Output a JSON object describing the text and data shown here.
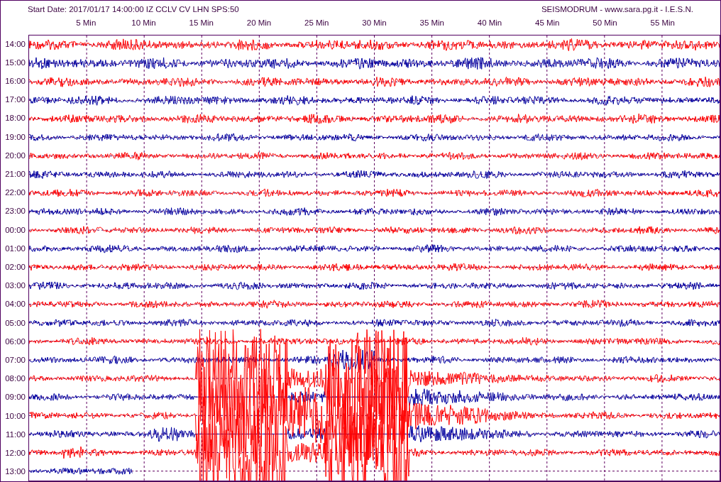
{
  "header": {
    "start_info": "Start Date: 2017/01/17 14:00:00 IZ CCLV CV LHN SPS:50",
    "credits": "SEISMODRUM - www.sara.pg.it - I.E.S.N."
  },
  "minute_labels": [
    "5 Min",
    "10 Min",
    "15 Min",
    "20 Min",
    "25 Min",
    "30 Min",
    "35 Min",
    "40 Min",
    "45 Min",
    "50 Min",
    "55 Min"
  ],
  "rows": [
    {
      "label": "14:00",
      "color": "#ff0000",
      "level": 1
    },
    {
      "label": "15:00",
      "color": "#0000a0",
      "level": 1
    },
    {
      "label": "16:00",
      "color": "#ff0000",
      "level": 1
    },
    {
      "label": "17:00",
      "color": "#0000a0",
      "level": 1
    },
    {
      "label": "18:00",
      "color": "#ff0000",
      "level": 1
    },
    {
      "label": "19:00",
      "color": "#0000a0",
      "level": 1
    },
    {
      "label": "20:00",
      "color": "#ff0000",
      "level": 1
    },
    {
      "label": "21:00",
      "color": "#0000a0",
      "level": 1
    },
    {
      "label": "22:00",
      "color": "#ff0000",
      "level": 1
    },
    {
      "label": "23:00",
      "color": "#0000a0",
      "level": 1
    },
    {
      "label": "00:00",
      "color": "#ff0000",
      "level": 1
    },
    {
      "label": "01:00",
      "color": "#0000a0",
      "level": 1
    },
    {
      "label": "02:00",
      "color": "#ff0000",
      "level": 1
    },
    {
      "label": "03:00",
      "color": "#0000a0",
      "level": 1
    },
    {
      "label": "04:00",
      "color": "#ff0000",
      "level": 1
    },
    {
      "label": "05:00",
      "color": "#0000a0",
      "level": 1
    },
    {
      "label": "06:00",
      "color": "#ff0000",
      "level": 1
    },
    {
      "label": "07:00",
      "color": "#0000a0",
      "level": 1
    },
    {
      "label": "08:00",
      "color": "#ff0000",
      "level": 1
    },
    {
      "label": "09:00",
      "color": "#0000a0",
      "level": 1
    },
    {
      "label": "10:00",
      "color": "#ff0000",
      "level": 1
    },
    {
      "label": "11:00",
      "color": "#0000a0",
      "level": 1
    },
    {
      "label": "12:00",
      "color": "#ff0000",
      "level": 1
    },
    {
      "label": "13:00",
      "color": "#0000a0",
      "level": 0.15
    }
  ]
}
